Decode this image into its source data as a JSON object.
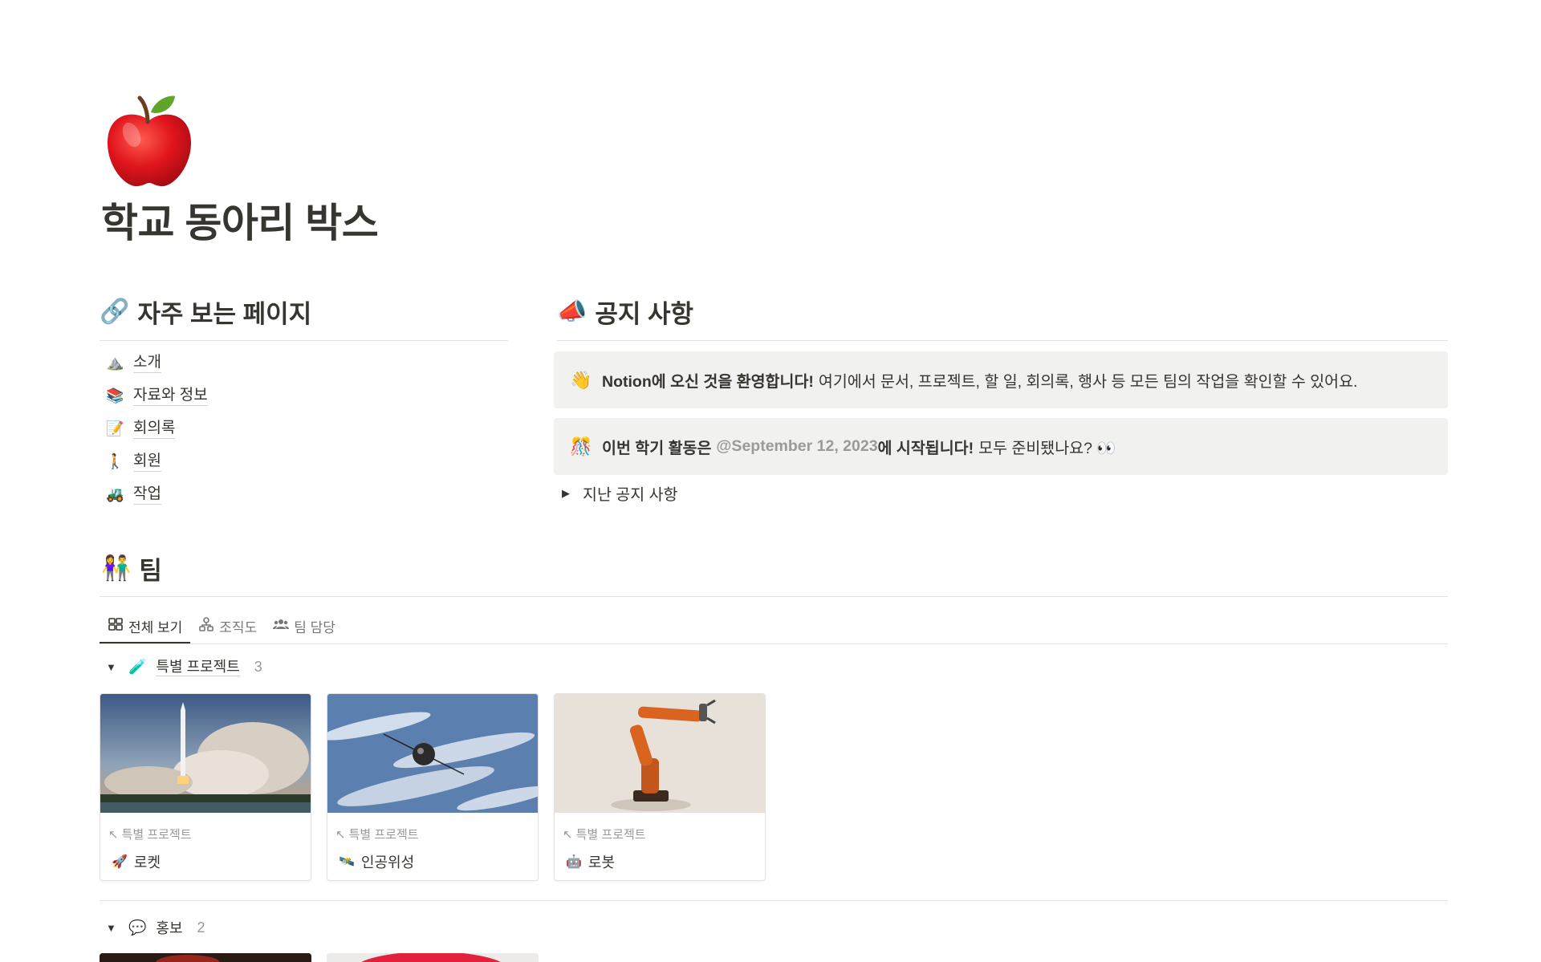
{
  "page": {
    "icon": "red-apple",
    "title": "학교 동아리 박스"
  },
  "frequent": {
    "emoji": "🔗",
    "heading": "자주 보는 페이지",
    "items": [
      {
        "emoji": "⛰️",
        "label": "소개"
      },
      {
        "emoji": "📚",
        "label": "자료와 정보"
      },
      {
        "emoji": "📝",
        "label": "회의록"
      },
      {
        "emoji": "🚶",
        "label": "회원"
      },
      {
        "emoji": "🚜",
        "label": "작업"
      }
    ]
  },
  "notice": {
    "emoji": "📣",
    "heading": "공지 사항",
    "callout1": {
      "emoji": "👋",
      "bold": "Notion에 오신 것을 환영합니다!",
      "text": "여기에서 문서, 프로젝트, 할 일, 회의록, 행사 등 모든 팀의 작업을 확인할 수 있어요."
    },
    "callout2": {
      "emoji": "🎊",
      "bold_before": "이번 학기 활동은",
      "mention": "@September 12, 2023",
      "bold_after": "에 시작됩니다!",
      "text": "모두 준비됐나요? 👀"
    },
    "toggle_label": "지난 공지 사항"
  },
  "team": {
    "emoji": "👫",
    "heading": "팀",
    "tabs": [
      {
        "icon": "gallery-icon",
        "label": "전체 보기",
        "active": true
      },
      {
        "icon": "org-chart-icon",
        "label": "조직도",
        "active": false
      },
      {
        "icon": "people-icon",
        "label": "팀 담당",
        "active": false
      }
    ],
    "groups": [
      {
        "emoji": "🧪",
        "label": "특별 프로젝트",
        "count": "3",
        "cards": [
          {
            "cover": "rocket-launch",
            "meta": "특별 프로젝트",
            "emoji": "🚀",
            "name": "로켓"
          },
          {
            "cover": "satellite-orbit",
            "meta": "특별 프로젝트",
            "emoji": "🛰️",
            "name": "인공위성"
          },
          {
            "cover": "robot-arm",
            "meta": "특별 프로젝트",
            "emoji": "🤖",
            "name": "로봇"
          }
        ]
      },
      {
        "emoji": "💬",
        "label": "홍보",
        "count": "2"
      }
    ]
  },
  "colors": {
    "text": "#37352f",
    "muted": "#9b9a97",
    "callout_bg": "#f1f1ef",
    "divider": "#e3e2e0"
  }
}
